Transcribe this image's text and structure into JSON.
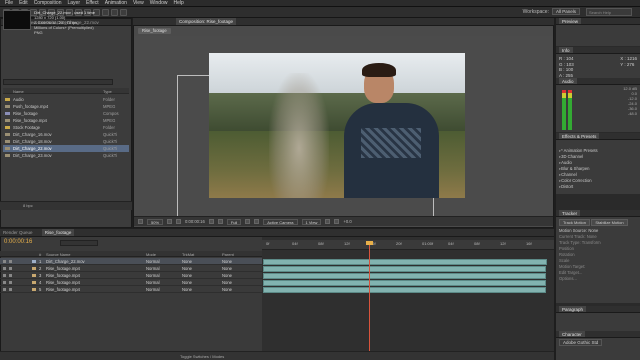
{
  "menu": [
    "File",
    "Edit",
    "Composition",
    "Layer",
    "Effect",
    "Animation",
    "View",
    "Window",
    "Help"
  ],
  "toolbar": {
    "workspace_label": "Workspace:",
    "workspace_value": "All Panels",
    "search_placeholder": "Search Help"
  },
  "project": {
    "tab_label": "Project",
    "effect_controls_tab": "Effect Controls: Dirt_Charge_22.mov",
    "selected_name": "Dirt_Charge_22.mov , used 1 time",
    "selected_info": [
      "1280 x 720 (1.00)",
      "Δ 0:00:06:18, 23.976 fps",
      "Millions of Colors+ (Premultiplied)",
      "PNG"
    ],
    "col_name": "Name",
    "col_type": "Type",
    "items": [
      {
        "name": "Audio",
        "type": "Folder",
        "icon": "folder"
      },
      {
        "name": "Push_footage.mp4",
        "type": "MPEG",
        "icon": "footage"
      },
      {
        "name": "Rise_footage",
        "type": "Compos",
        "icon": "comp"
      },
      {
        "name": "Rise_footage.mp4",
        "type": "MPEG",
        "icon": "footage"
      },
      {
        "name": "Stock Footage",
        "type": "Folder",
        "icon": "folder"
      },
      {
        "name": "Dirt_Charge_16.mov",
        "type": "QuickTi",
        "icon": "footage"
      },
      {
        "name": "Dirt_Charge_18.mov",
        "type": "QuickTi",
        "icon": "footage"
      },
      {
        "name": "Dirt_Charge_22.mov",
        "type": "QuickTi",
        "icon": "footage",
        "selected": true
      },
      {
        "name": "Dirt_Charge_23.mov",
        "type": "QuickTi",
        "icon": "footage"
      }
    ],
    "footer": "8 bpc"
  },
  "composition": {
    "tab_label": "Composition: Rise_footage",
    "breadcrumb": "Rise_footage",
    "zoom": "50%",
    "timecode": "0:00:00:16",
    "resolution": "Full",
    "camera": "Active Camera",
    "view": "1 View",
    "offset": "+0.0"
  },
  "preview": {
    "tab_label": "Preview"
  },
  "info": {
    "tab_label": "Info",
    "lines": [
      "R : 104",
      "G : 103",
      "B : 100",
      "A : 255"
    ],
    "coords": [
      "X : 1216",
      "Y : 276"
    ]
  },
  "audio": {
    "tab_label": "Audio",
    "scale": [
      "12.0 dB",
      "0.0",
      "-12.0",
      "-24.0",
      "-36.0",
      "-48.0"
    ]
  },
  "effects": {
    "tab_label": "Effects & Presets",
    "items": [
      "* Animation Presets",
      "3D Channel",
      "Audio",
      "Blur & Sharpen",
      "Channel",
      "Color Correction",
      "Distort"
    ]
  },
  "tracker": {
    "tab_label": "Tracker",
    "buttons": [
      "Track Motion",
      "Stabilize Motion"
    ],
    "rows": [
      "Motion Source:  None",
      "Current Track:  None",
      "Track Type:  Transform",
      "Position",
      "Rotation",
      "Scale",
      "Motion Target:",
      "Edit Target...",
      "Options..."
    ]
  },
  "paragraph": {
    "tab_label": "Paragraph"
  },
  "character": {
    "tab_label": "Character",
    "font": "Adobe Gothic Std"
  },
  "timeline": {
    "tab_render": "Render Queue",
    "tab_comp": "Rise_footage",
    "timecode": "0:00:00:16",
    "headers": {
      "num": "#",
      "name": "Source Name",
      "mode": "Mode",
      "trkmat": "TrkMat",
      "parent": "Parent"
    },
    "ruler": [
      "0f",
      "04f",
      "08f",
      "12f",
      "16f",
      "20f",
      "01:00f",
      "04f",
      "08f",
      "12f",
      "16f"
    ],
    "layers": [
      {
        "num": "1",
        "name": "Dirt_Charge_22.mov",
        "mode": "Normal",
        "trk": "None",
        "parent": "None",
        "color": "#9fb0c8",
        "selected": true
      },
      {
        "num": "2",
        "name": "Rise_footage.mp4",
        "mode": "Normal",
        "trk": "None",
        "parent": "None",
        "color": "#c8a870"
      },
      {
        "num": "3",
        "name": "Rise_footage.mp4",
        "mode": "Normal",
        "trk": "None",
        "parent": "None",
        "color": "#c8a870"
      },
      {
        "num": "4",
        "name": "Rise_footage.mp4",
        "mode": "Normal",
        "trk": "None",
        "parent": "None",
        "color": "#c8a870"
      },
      {
        "num": "5",
        "name": "Rise_footage.mp4",
        "mode": "Normal",
        "trk": "None",
        "parent": "None",
        "color": "#c8a870"
      }
    ],
    "footer": "Toggle Switches / Modes"
  },
  "colors": {
    "accent_timecode": "#e8b04a",
    "playhead": "#d9543c",
    "layer_bar": "#82b3b0",
    "selection": "#596b86"
  }
}
